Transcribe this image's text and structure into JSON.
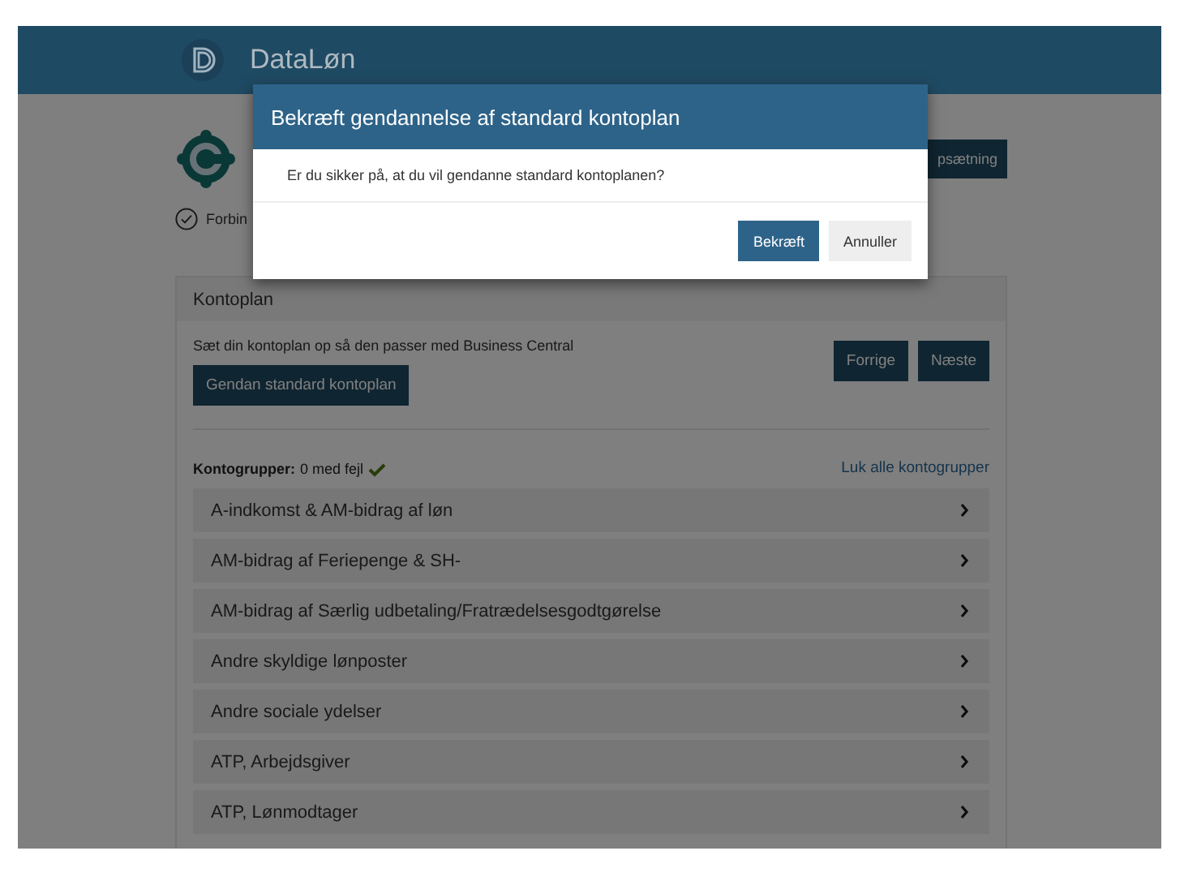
{
  "header": {
    "app_name": "DataLøn"
  },
  "company": {
    "status": "Forbin"
  },
  "setup_button": "psætning",
  "panel": {
    "title": "Kontoplan",
    "description": "Sæt din kontoplan op så den passer med Business Central",
    "restore_button": "Gendan standard kontoplan",
    "prev_button": "Forrige",
    "next_button": "Næste",
    "groups_label": "Kontogrupper:",
    "groups_status": "0 med fejl",
    "collapse_link": "Luk alle kontogrupper",
    "groups": [
      {
        "label": "A-indkomst & AM-bidrag af løn",
        "expanded": false
      },
      {
        "label": "AM-bidrag af Feriepenge & SH-",
        "expanded": false
      },
      {
        "label": "AM-bidrag af Særlig udbetaling/Fratrædelsesgodtgørelse",
        "expanded": false
      },
      {
        "label": "Andre skyldige lønposter",
        "expanded": false
      },
      {
        "label": "Andre sociale ydelser",
        "expanded": false
      },
      {
        "label": "ATP, Arbejdsgiver",
        "expanded": false
      },
      {
        "label": "ATP, Lønmodtager",
        "expanded": false
      }
    ]
  },
  "dialog": {
    "title": "Bekræft gendannelse af standard kontoplan",
    "message": "Er du sikker på, at du vil gendanne standard kontoplanen?",
    "confirm": "Bekræft",
    "cancel": "Annuller"
  }
}
